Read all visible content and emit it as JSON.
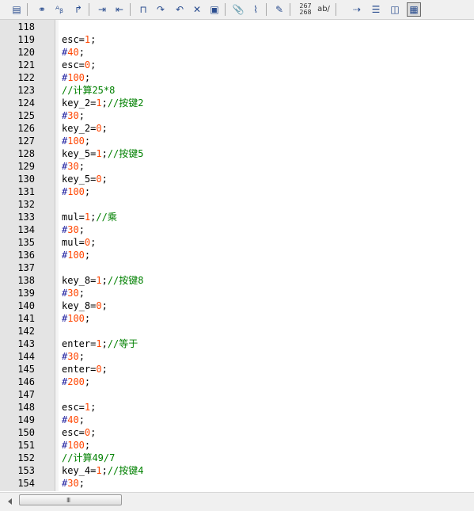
{
  "toolbar": {
    "buttons": [
      {
        "name": "new-file-icon",
        "glyph": "▤",
        "active": false
      },
      {
        "name": "find-icon",
        "glyph": "⚭",
        "active": false
      },
      {
        "name": "find-replace-icon",
        "glyph": "ᴬᵦ",
        "active": false
      },
      {
        "name": "goto-icon",
        "glyph": "↱",
        "active": false
      },
      {
        "name": "indent-icon",
        "glyph": "⇥",
        "active": false
      },
      {
        "name": "outdent-icon",
        "glyph": "⇤",
        "active": false
      },
      {
        "name": "bookmark-icon",
        "glyph": "⊓",
        "active": false
      },
      {
        "name": "bookmark-next-icon",
        "glyph": "↷",
        "active": false
      },
      {
        "name": "bookmark-prev-icon",
        "glyph": "↶",
        "active": false
      },
      {
        "name": "bookmark-clear-icon",
        "glyph": "✕",
        "active": false
      },
      {
        "name": "bookmark-clear-all-icon",
        "glyph": "▣",
        "active": false
      },
      {
        "name": "paperclip-icon",
        "glyph": "📎",
        "active": false
      },
      {
        "name": "scroll-icon",
        "glyph": "⌇",
        "active": false
      },
      {
        "name": "edit-pen-icon",
        "glyph": "✎",
        "active": false
      },
      {
        "name": "word-count-icon",
        "glyph": "",
        "lines": [
          "267",
          "268"
        ],
        "active": false
      },
      {
        "name": "spell-check-icon",
        "glyph": "ab/",
        "active": false
      },
      {
        "name": "wrap-arrow-icon",
        "glyph": "⇢",
        "active": false
      },
      {
        "name": "line-numbers-icon",
        "glyph": "☰",
        "active": false
      },
      {
        "name": "column-icon",
        "glyph": "◫",
        "active": false
      },
      {
        "name": "ruler-icon",
        "glyph": "▦",
        "active": true
      }
    ]
  },
  "editor": {
    "lines": [
      {
        "n": "118",
        "tokens": []
      },
      {
        "n": "119",
        "tokens": [
          {
            "t": "esc=",
            "k": "txt"
          },
          {
            "t": "1",
            "k": "num"
          },
          {
            "t": ";",
            "k": "txt"
          }
        ]
      },
      {
        "n": "120",
        "tokens": [
          {
            "t": "#",
            "k": "pre"
          },
          {
            "t": "40",
            "k": "num"
          },
          {
            "t": ";",
            "k": "txt"
          }
        ]
      },
      {
        "n": "121",
        "tokens": [
          {
            "t": "esc=",
            "k": "txt"
          },
          {
            "t": "0",
            "k": "num"
          },
          {
            "t": ";",
            "k": "txt"
          }
        ]
      },
      {
        "n": "122",
        "tokens": [
          {
            "t": "#",
            "k": "pre"
          },
          {
            "t": "100",
            "k": "num"
          },
          {
            "t": ";",
            "k": "txt"
          }
        ]
      },
      {
        "n": "123",
        "tokens": [
          {
            "t": "//计算25*8",
            "k": "cmt"
          }
        ]
      },
      {
        "n": "124",
        "tokens": [
          {
            "t": "key_2=",
            "k": "txt"
          },
          {
            "t": "1",
            "k": "num"
          },
          {
            "t": ";",
            "k": "txt"
          },
          {
            "t": "//按键2",
            "k": "cmt"
          }
        ]
      },
      {
        "n": "125",
        "tokens": [
          {
            "t": "#",
            "k": "pre"
          },
          {
            "t": "30",
            "k": "num"
          },
          {
            "t": ";",
            "k": "txt"
          }
        ]
      },
      {
        "n": "126",
        "tokens": [
          {
            "t": "key_2=",
            "k": "txt"
          },
          {
            "t": "0",
            "k": "num"
          },
          {
            "t": ";",
            "k": "txt"
          }
        ]
      },
      {
        "n": "127",
        "tokens": [
          {
            "t": "#",
            "k": "pre"
          },
          {
            "t": "100",
            "k": "num"
          },
          {
            "t": ";",
            "k": "txt"
          }
        ]
      },
      {
        "n": "128",
        "tokens": [
          {
            "t": "key_5=",
            "k": "txt"
          },
          {
            "t": "1",
            "k": "num"
          },
          {
            "t": ";",
            "k": "txt"
          },
          {
            "t": "//按键5",
            "k": "cmt"
          }
        ]
      },
      {
        "n": "129",
        "tokens": [
          {
            "t": "#",
            "k": "pre"
          },
          {
            "t": "30",
            "k": "num"
          },
          {
            "t": ";",
            "k": "txt"
          }
        ]
      },
      {
        "n": "130",
        "tokens": [
          {
            "t": "key_5=",
            "k": "txt"
          },
          {
            "t": "0",
            "k": "num"
          },
          {
            "t": ";",
            "k": "txt"
          }
        ]
      },
      {
        "n": "131",
        "tokens": [
          {
            "t": "#",
            "k": "pre"
          },
          {
            "t": "100",
            "k": "num"
          },
          {
            "t": ";",
            "k": "txt"
          }
        ]
      },
      {
        "n": "132",
        "tokens": []
      },
      {
        "n": "133",
        "tokens": [
          {
            "t": "mul=",
            "k": "txt"
          },
          {
            "t": "1",
            "k": "num"
          },
          {
            "t": ";",
            "k": "txt"
          },
          {
            "t": "//乘",
            "k": "cmt"
          }
        ]
      },
      {
        "n": "134",
        "tokens": [
          {
            "t": "#",
            "k": "pre"
          },
          {
            "t": "30",
            "k": "num"
          },
          {
            "t": ";",
            "k": "txt"
          }
        ]
      },
      {
        "n": "135",
        "tokens": [
          {
            "t": "mul=",
            "k": "txt"
          },
          {
            "t": "0",
            "k": "num"
          },
          {
            "t": ";",
            "k": "txt"
          }
        ]
      },
      {
        "n": "136",
        "tokens": [
          {
            "t": "#",
            "k": "pre"
          },
          {
            "t": "100",
            "k": "num"
          },
          {
            "t": ";",
            "k": "txt"
          }
        ]
      },
      {
        "n": "137",
        "tokens": []
      },
      {
        "n": "138",
        "tokens": [
          {
            "t": "key_8=",
            "k": "txt"
          },
          {
            "t": "1",
            "k": "num"
          },
          {
            "t": ";",
            "k": "txt"
          },
          {
            "t": "//按键8",
            "k": "cmt"
          }
        ]
      },
      {
        "n": "139",
        "tokens": [
          {
            "t": "#",
            "k": "pre"
          },
          {
            "t": "30",
            "k": "num"
          },
          {
            "t": ";",
            "k": "txt"
          }
        ]
      },
      {
        "n": "140",
        "tokens": [
          {
            "t": "key_8=",
            "k": "txt"
          },
          {
            "t": "0",
            "k": "num"
          },
          {
            "t": ";",
            "k": "txt"
          }
        ]
      },
      {
        "n": "141",
        "tokens": [
          {
            "t": "#",
            "k": "pre"
          },
          {
            "t": "100",
            "k": "num"
          },
          {
            "t": ";",
            "k": "txt"
          }
        ]
      },
      {
        "n": "142",
        "tokens": []
      },
      {
        "n": "143",
        "tokens": [
          {
            "t": "enter=",
            "k": "txt"
          },
          {
            "t": "1",
            "k": "num"
          },
          {
            "t": ";",
            "k": "txt"
          },
          {
            "t": "//等于",
            "k": "cmt"
          }
        ]
      },
      {
        "n": "144",
        "tokens": [
          {
            "t": "#",
            "k": "pre"
          },
          {
            "t": "30",
            "k": "num"
          },
          {
            "t": ";",
            "k": "txt"
          }
        ]
      },
      {
        "n": "145",
        "tokens": [
          {
            "t": "enter=",
            "k": "txt"
          },
          {
            "t": "0",
            "k": "num"
          },
          {
            "t": ";",
            "k": "txt"
          }
        ]
      },
      {
        "n": "146",
        "tokens": [
          {
            "t": "#",
            "k": "pre"
          },
          {
            "t": "200",
            "k": "num"
          },
          {
            "t": ";",
            "k": "txt"
          }
        ]
      },
      {
        "n": "147",
        "tokens": []
      },
      {
        "n": "148",
        "tokens": [
          {
            "t": "esc=",
            "k": "txt"
          },
          {
            "t": "1",
            "k": "num"
          },
          {
            "t": ";",
            "k": "txt"
          }
        ]
      },
      {
        "n": "149",
        "tokens": [
          {
            "t": "#",
            "k": "pre"
          },
          {
            "t": "40",
            "k": "num"
          },
          {
            "t": ";",
            "k": "txt"
          }
        ]
      },
      {
        "n": "150",
        "tokens": [
          {
            "t": "esc=",
            "k": "txt"
          },
          {
            "t": "0",
            "k": "num"
          },
          {
            "t": ";",
            "k": "txt"
          }
        ]
      },
      {
        "n": "151",
        "tokens": [
          {
            "t": "#",
            "k": "pre"
          },
          {
            "t": "100",
            "k": "num"
          },
          {
            "t": ";",
            "k": "txt"
          }
        ]
      },
      {
        "n": "152",
        "tokens": [
          {
            "t": "//计算49/7",
            "k": "cmt"
          }
        ]
      },
      {
        "n": "153",
        "tokens": [
          {
            "t": "key_4=",
            "k": "txt"
          },
          {
            "t": "1",
            "k": "num"
          },
          {
            "t": ";",
            "k": "txt"
          },
          {
            "t": "//按键4",
            "k": "cmt"
          }
        ]
      },
      {
        "n": "154",
        "tokens": [
          {
            "t": "#",
            "k": "pre"
          },
          {
            "t": "30",
            "k": "num"
          },
          {
            "t": ";",
            "k": "txt"
          }
        ]
      }
    ]
  },
  "scrollbar": {
    "grip": "III"
  },
  "colors": {
    "number": "#ff4500",
    "preprocessor": "#2020a0",
    "comment": "#008000",
    "gutter": "#e4e4e4"
  }
}
